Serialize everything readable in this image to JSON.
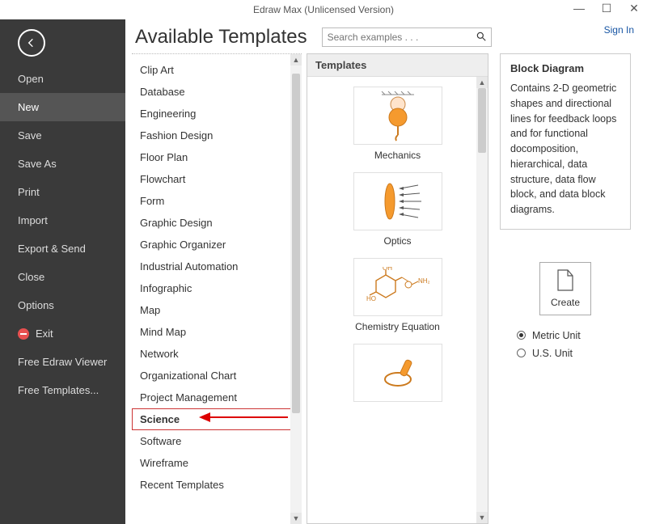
{
  "window": {
    "title": "Edraw Max (Unlicensed Version)",
    "sign_in": "Sign In"
  },
  "sidebar": {
    "items": [
      {
        "label": "Open"
      },
      {
        "label": "New",
        "active": true
      },
      {
        "label": "Save"
      },
      {
        "label": "Save As"
      },
      {
        "label": "Print"
      },
      {
        "label": "Import"
      },
      {
        "label": "Export & Send"
      },
      {
        "label": "Close"
      },
      {
        "label": "Options"
      },
      {
        "label": "Exit",
        "exit": true
      },
      {
        "label": "Free Edraw Viewer"
      },
      {
        "label": "Free Templates..."
      }
    ]
  },
  "heading": "Available Templates",
  "search": {
    "placeholder": "Search examples . . ."
  },
  "categories": [
    "Clip Art",
    "Database",
    "Engineering",
    "Fashion Design",
    "Floor Plan",
    "Flowchart",
    "Form",
    "Graphic Design",
    "Graphic Organizer",
    "Industrial Automation",
    "Infographic",
    "Map",
    "Mind Map",
    "Network",
    "Organizational Chart",
    "Project Management",
    "Science",
    "Software",
    "Wireframe",
    "Recent Templates"
  ],
  "selected_category_index": 16,
  "templates_header": "Templates",
  "templates": [
    {
      "label": "Mechanics"
    },
    {
      "label": "Optics"
    },
    {
      "label": "Chemistry Equation"
    }
  ],
  "info": {
    "title": "Block Diagram",
    "desc": "Contains 2-D geometric shapes and directional lines for feedback loops and for functional docomposition, hierarchical, data structure, data flow block, and data block diagrams."
  },
  "create_label": "Create",
  "units": {
    "metric": "Metric Unit",
    "us": "U.S. Unit",
    "selected": "metric"
  }
}
